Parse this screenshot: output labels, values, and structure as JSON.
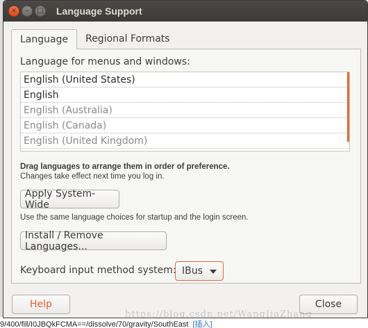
{
  "window": {
    "title": "Language Support",
    "close_glyph": "×",
    "minimize_glyph": "–",
    "maximize_glyph": "□"
  },
  "tabs": [
    {
      "label": "Language"
    },
    {
      "label": "Regional Formats"
    }
  ],
  "language_tab": {
    "heading": "Language for menus and windows:",
    "languages": [
      {
        "label": "English (United States)"
      },
      {
        "label": "English"
      },
      {
        "label": "English (Australia)"
      },
      {
        "label": "English (Canada)"
      },
      {
        "label": "English (United Kingdom)"
      }
    ],
    "drag_hint": "Drag languages to arrange them in order of preference.",
    "drag_hint_sub": "Changes take effect next time you log in.",
    "apply_button": "Apply System-Wide",
    "apply_desc": "Use the same language choices for startup and the login screen.",
    "install_button": "Install / Remove Languages...",
    "keyboard_label": "Keyboard input method system:",
    "keyboard_value": "IBus"
  },
  "footer": {
    "help_button": "Help",
    "close_button": "Close"
  },
  "background": {
    "url_text": "9/400/fill/I0JBQkFCMA==/dissolve/70/gravity/SouthEast",
    "link_text": "[插入]",
    "watermark": "https://blog.csdn.net/WangJiaZhang"
  },
  "colors": {
    "accent": "#e46a2f",
    "titlebar": "#3c3b37",
    "window_bg": "#f2f1f0"
  }
}
